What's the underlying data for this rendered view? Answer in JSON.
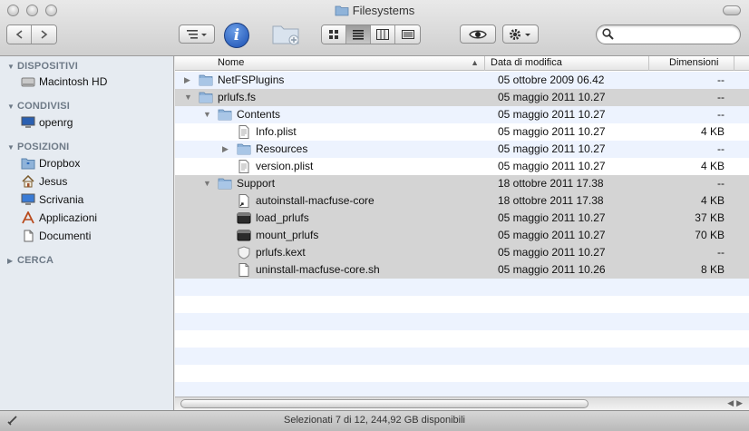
{
  "window": {
    "title": "Filesystems"
  },
  "sidebar": {
    "sections": [
      {
        "label": "DISPOSITIVI",
        "items": [
          {
            "label": "Macintosh HD",
            "icon": "hard-drive-icon"
          }
        ]
      },
      {
        "label": "CONDIVISI",
        "items": [
          {
            "label": "openrg",
            "icon": "computer-icon"
          }
        ]
      },
      {
        "label": "POSIZIONI",
        "items": [
          {
            "label": "Dropbox",
            "icon": "dropbox-folder-icon"
          },
          {
            "label": "Jesus",
            "icon": "home-icon"
          },
          {
            "label": "Scrivania",
            "icon": "desktop-icon"
          },
          {
            "label": "Applicazioni",
            "icon": "applications-icon"
          },
          {
            "label": "Documenti",
            "icon": "document-icon"
          }
        ]
      },
      {
        "label": "CERCA",
        "items": []
      }
    ]
  },
  "list": {
    "columns": {
      "name": "Nome",
      "date": "Data di modifica",
      "size": "Dimensioni"
    },
    "rows": [
      {
        "name": "NetFSPlugins",
        "date": "05 ottobre 2009 06.42",
        "size": "--",
        "indent": 0,
        "disclosure": "closed",
        "icon": "folder",
        "selected": false
      },
      {
        "name": "prlufs.fs",
        "date": "05 maggio 2011 10.27",
        "size": "--",
        "indent": 0,
        "disclosure": "open",
        "icon": "folder",
        "selected": true
      },
      {
        "name": "Contents",
        "date": "05 maggio 2011 10.27",
        "size": "--",
        "indent": 1,
        "disclosure": "open",
        "icon": "folder",
        "selected": false
      },
      {
        "name": "Info.plist",
        "date": "05 maggio 2011 10.27",
        "size": "4 KB",
        "indent": 2,
        "disclosure": "none",
        "icon": "plist",
        "selected": false
      },
      {
        "name": "Resources",
        "date": "05 maggio 2011 10.27",
        "size": "--",
        "indent": 2,
        "disclosure": "closed",
        "icon": "folder",
        "selected": false
      },
      {
        "name": "version.plist",
        "date": "05 maggio 2011 10.27",
        "size": "4 KB",
        "indent": 2,
        "disclosure": "none",
        "icon": "plist",
        "selected": false
      },
      {
        "name": "Support",
        "date": "18 ottobre 2011 17.38",
        "size": "--",
        "indent": 1,
        "disclosure": "open",
        "icon": "folder",
        "selected": true
      },
      {
        "name": "autoinstall-macfuse-core",
        "date": "18 ottobre 2011 17.38",
        "size": "4 KB",
        "indent": 2,
        "disclosure": "none",
        "icon": "alias",
        "selected": true
      },
      {
        "name": "load_prlufs",
        "date": "05 maggio 2011 10.27",
        "size": "37 KB",
        "indent": 2,
        "disclosure": "none",
        "icon": "exec",
        "selected": true
      },
      {
        "name": "mount_prlufs",
        "date": "05 maggio 2011 10.27",
        "size": "70 KB",
        "indent": 2,
        "disclosure": "none",
        "icon": "exec",
        "selected": true
      },
      {
        "name": "prlufs.kext",
        "date": "05 maggio 2011 10.27",
        "size": "--",
        "indent": 2,
        "disclosure": "none",
        "icon": "kext",
        "selected": true
      },
      {
        "name": "uninstall-macfuse-core.sh",
        "date": "05 maggio 2011 10.26",
        "size": "8 KB",
        "indent": 2,
        "disclosure": "none",
        "icon": "doc",
        "selected": true
      }
    ]
  },
  "status": {
    "text": "Selezionati 7 di 12, 244,92 GB disponibili"
  },
  "colors": {
    "selection": "#d4d4d4",
    "stripe": "#edf3fe",
    "sidebar": "#e6ebf1",
    "folder": "#8fb3d9"
  }
}
